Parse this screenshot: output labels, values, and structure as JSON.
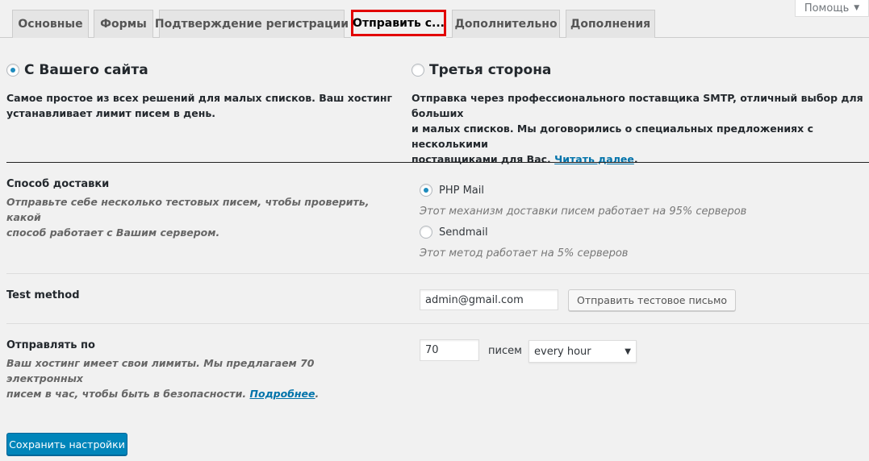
{
  "help": {
    "label": "Помощь"
  },
  "tabs": [
    {
      "label": "Основные"
    },
    {
      "label": "Формы"
    },
    {
      "label": "Подтверждение регистрации"
    },
    {
      "label": "Отправить с..."
    },
    {
      "label": "Дополнительно"
    },
    {
      "label": "Дополнения"
    }
  ],
  "sending": {
    "own": {
      "title": "С Вашего сайта",
      "desc_line1": "Самое простое из всех решений для малых списков. Ваш хостинг",
      "desc_line2": "устанавливает лимит писем в день."
    },
    "third": {
      "title": "Третья сторона",
      "desc_line1": "Отправка через профессионального поставщика SMTP, отличный выбор для больших",
      "desc_line2": "и малых списков. Мы договорились о специальных предложениях с несколькими",
      "desc_line3": "поставщиками для Вас.",
      "link": "Читать далее",
      "period": "."
    }
  },
  "delivery": {
    "title": "Способ доставки",
    "desc_line1": "Отправьте себе несколько тестовых писем, чтобы проверить, какой",
    "desc_line2": "способ работает с Вашим сервером.",
    "options": [
      {
        "label": "PHP Mail",
        "desc": "Этот механизм доставки писем работает на 95% серверов"
      },
      {
        "label": "Sendmail",
        "desc": "Этот метод работает на 5% серверов"
      }
    ]
  },
  "test": {
    "title": "Test method",
    "email": "admin@gmail.com",
    "button": "Отправить тестовое письмо"
  },
  "frequency": {
    "title": "Отправлять по",
    "desc_line1": "Ваш хостинг имеет свои лимиты. Мы предлагаем 70 электронных",
    "desc_line2": "писем в час, чтобы быть в безопасности.",
    "link": "Подробнее",
    "period": ".",
    "count": "70",
    "unit": "писем",
    "interval": "every hour"
  },
  "save": {
    "label": "Сохранить настройки"
  },
  "colors": {
    "accent": "#0085ba",
    "highlight": "#e20000",
    "link": "#0073aa"
  }
}
